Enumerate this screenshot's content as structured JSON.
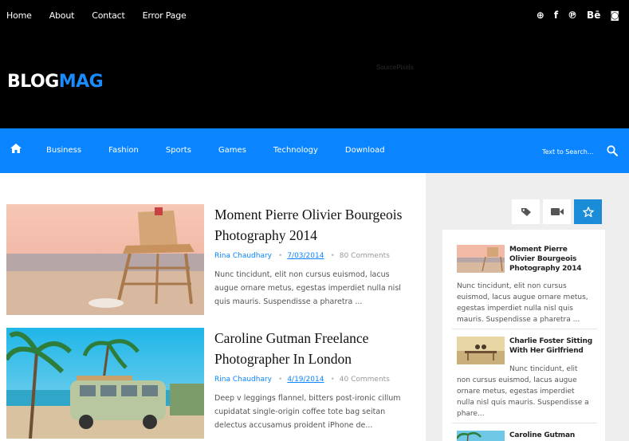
{
  "topnav": {
    "items": [
      "Home",
      "About",
      "Contact",
      "Error Page"
    ]
  },
  "social": {
    "icons": [
      "dribbble-icon",
      "facebook-icon",
      "pinterest-icon",
      "behance-icon",
      "instagram-icon"
    ],
    "glyphs": [
      "⊕",
      "f",
      "℗",
      "Bē",
      "◙"
    ]
  },
  "header": {
    "logo_white": "BLOG",
    "logo_blue": "MAG",
    "ad_text": "SourcePixels"
  },
  "mainnav": {
    "categories": [
      "Business",
      "Fashion",
      "Sports",
      "Games",
      "Technology",
      "Download"
    ],
    "search_placeholder": "Text to Search..."
  },
  "posts": [
    {
      "title": "Moment Pierre Olivier Bourgeois Photography 2014",
      "author": "Rina Chaudhary",
      "date": "7/03/2014",
      "comments": "80 Comments",
      "excerpt": "Nunc tincidunt, elit non cursus euismod, lacus augue ornare metus, egestas imperdiet nulla nisl quis mauris. Suspendisse a pharetra ..."
    },
    {
      "title": "Caroline Gutman Freelance Photographer In London",
      "author": "Rina Chaudhary",
      "date": "4/19/2014",
      "comments": "40 Comments",
      "excerpt": "Deep v leggings flannel, bitters post-ironic cillum cupidatat single-origin coffee tote bag seitan delectus accusamus proident iPhone de..."
    }
  ],
  "sidebar": {
    "tabs": [
      "tag-icon",
      "video-icon",
      "star-icon"
    ],
    "items": [
      {
        "title": "Moment Pierre Olivier Bourgeois Photography 2014",
        "excerpt": "Nunc tincidunt, elit non cursus euismod, lacus augue ornare metus, egestas imperdiet nulla nisl quis mauris. Suspendisse a pharetra ..."
      },
      {
        "title": "Charlie Foster Sitting With Her Girlfriend",
        "excerpt": "Nunc tincidunt, elit non cursus euismod, lacus augue ornare metus, egestas imperdiet nulla nisl quis mauris. Suspendisse a phare..."
      },
      {
        "title": "Caroline Gutman"
      }
    ]
  },
  "colors": {
    "accent": "#0a84ff",
    "topbar": "#000000",
    "sidebar_bg": "#eeeeee",
    "active_tab": "#1a8cd8"
  }
}
